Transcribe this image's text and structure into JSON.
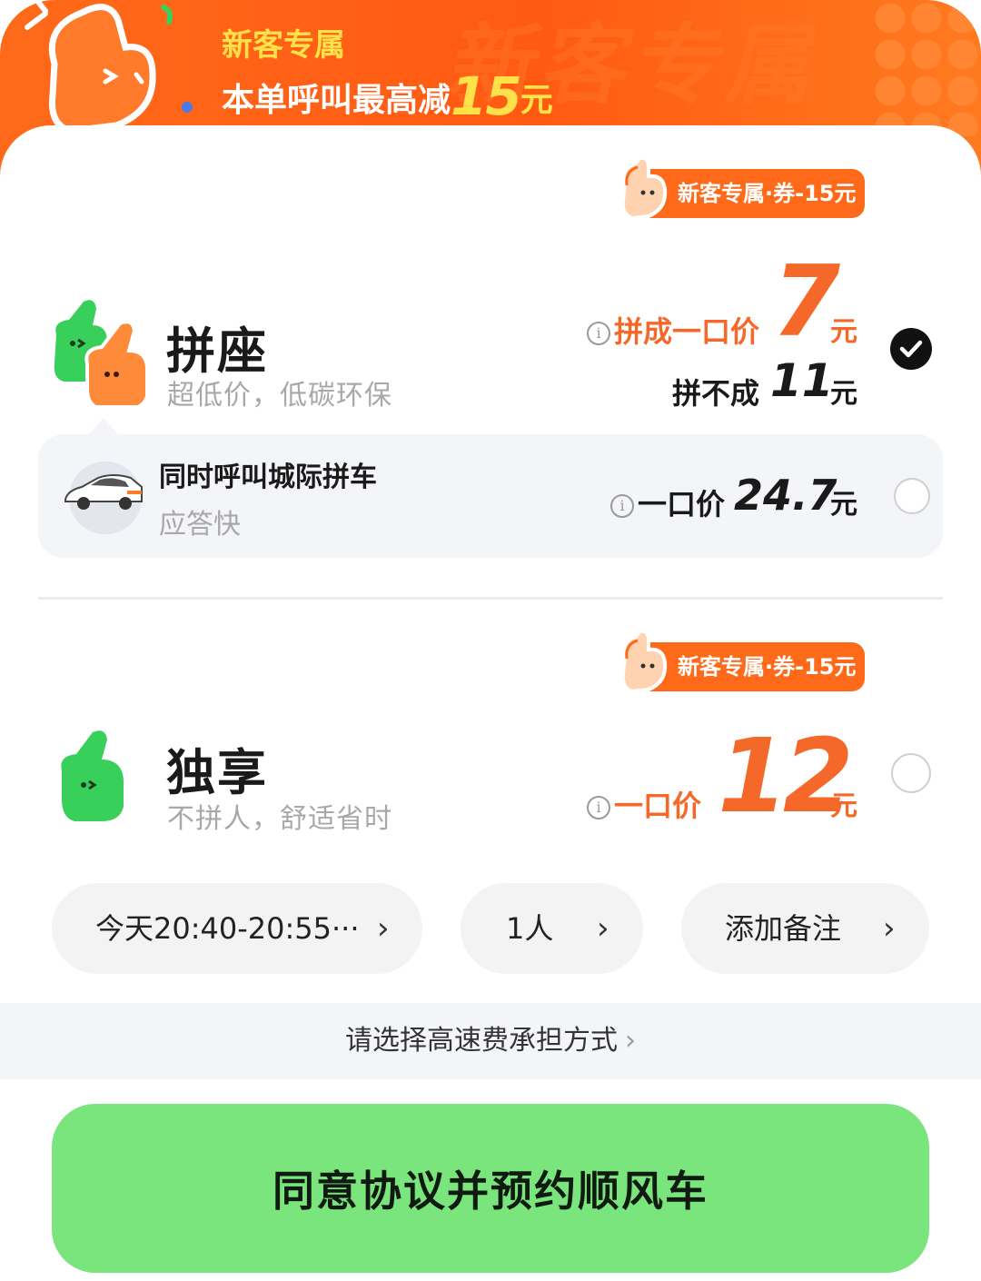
{
  "banner": {
    "title": "新客专属",
    "subtitle_prefix": "本单呼叫最高减",
    "subtitle_amount": "15",
    "subtitle_unit": "元",
    "watermark": "新客专属"
  },
  "options": [
    {
      "tag": "新客专属·券-15元",
      "name": "拼座",
      "desc": "超低价，低碳环保",
      "price_label": "拼成一口价",
      "price": "7",
      "unit": "元",
      "alt_label": "拼不成",
      "alt_price": "11",
      "alt_unit": "元",
      "selected": true,
      "sub_option": {
        "name": "同时呼叫城际拼车",
        "desc": "应答快",
        "price_label": "一口价",
        "price": "24.7",
        "unit": "元",
        "selected": false
      }
    },
    {
      "tag": "新客专属·券-15元",
      "name": "独享",
      "desc": "不拼人，舒适省时",
      "price_label": "一口价",
      "price": "12",
      "unit": "元",
      "selected": false
    }
  ],
  "info_glyph": "i",
  "chevron": "›",
  "pills": {
    "time": "今天20:40-20:55···",
    "passengers": "1人",
    "note": "添加备注"
  },
  "toll": "请选择高速费承担方式",
  "cta": "同意协议并预约顺风车",
  "colors": {
    "accent_orange": "#f4692a",
    "banner_orange": "#ff6a1a",
    "cta_green": "#7ae57d",
    "mascot_green": "#36d45a"
  },
  "icons": [
    "thumbs-up-mascot-icon",
    "coupon-hand-icon",
    "car-icon",
    "check-icon",
    "info-icon",
    "chevron-right-icon"
  ]
}
